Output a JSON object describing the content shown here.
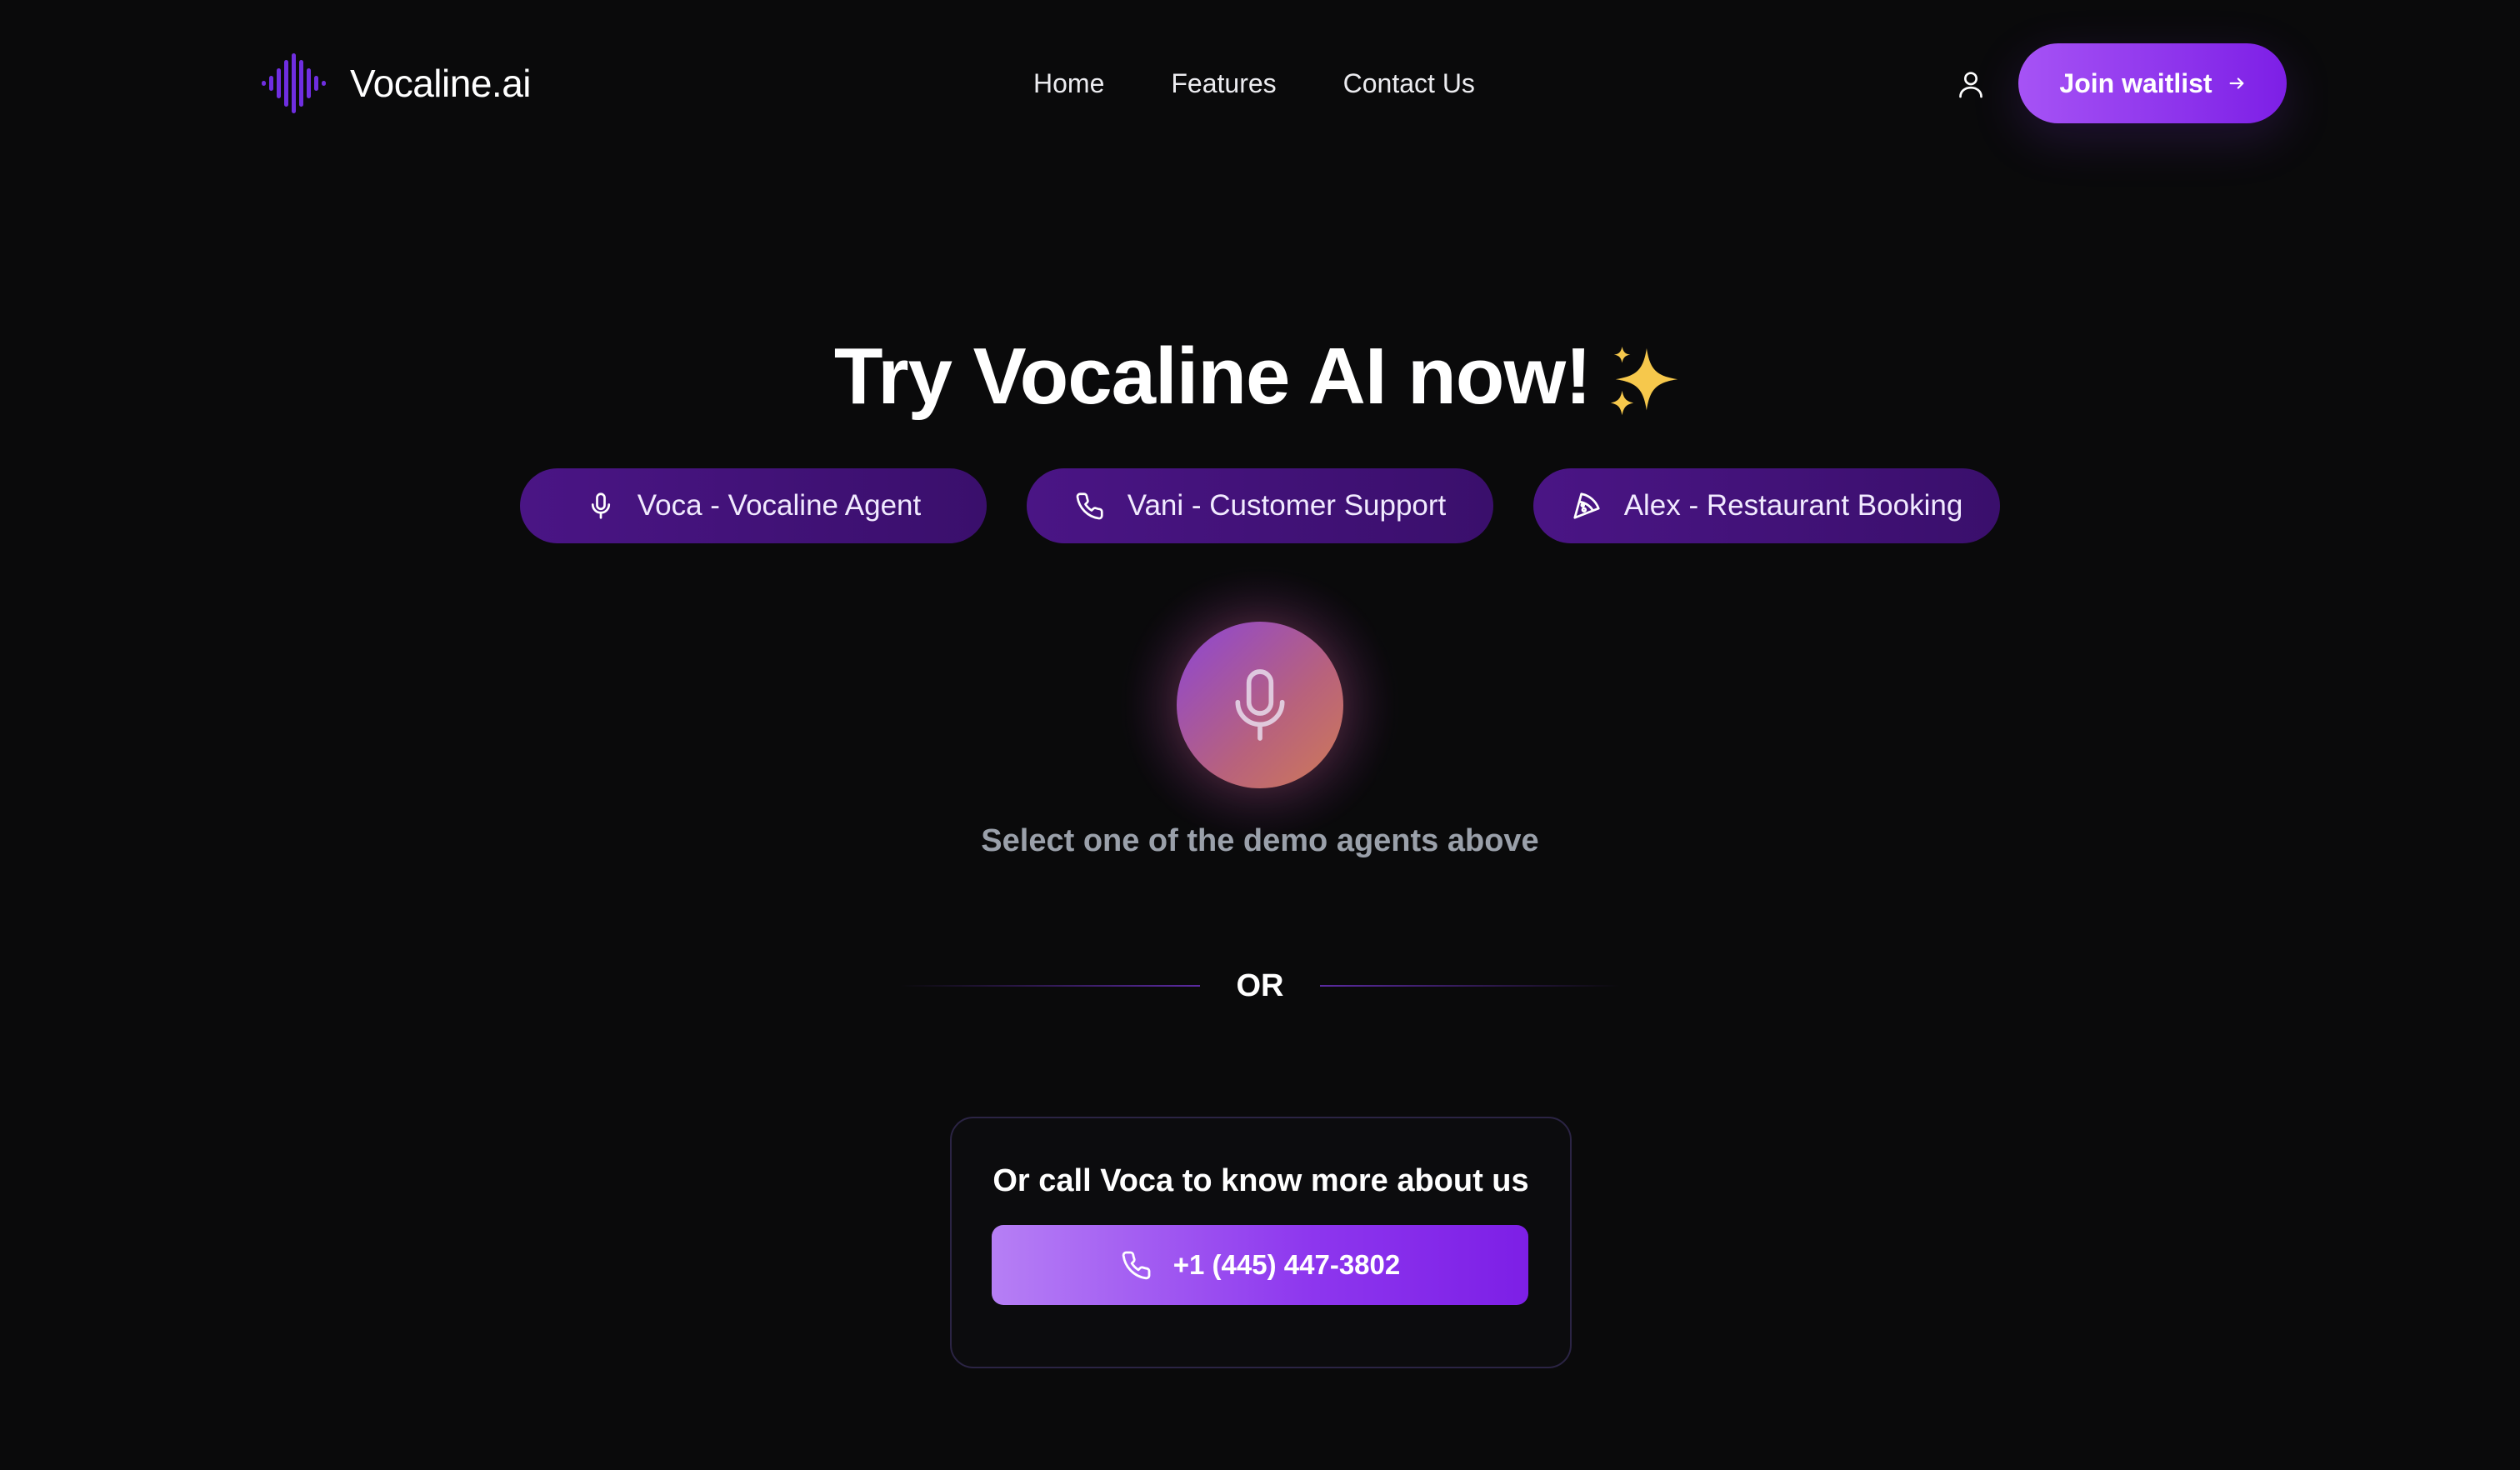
{
  "brand": {
    "name": "Vocaline.ai",
    "logo_icon": "waveform-icon",
    "accent": "#7b2ff0"
  },
  "nav": {
    "links": [
      {
        "label": "Home"
      },
      {
        "label": "Features"
      },
      {
        "label": "Contact Us"
      }
    ],
    "user_icon": "user-icon",
    "cta_label": "Join waitlist",
    "cta_icon": "arrow-right-icon"
  },
  "hero": {
    "title": "Try Vocaline AI now!",
    "title_icon": "sparkles-icon",
    "agents": [
      {
        "label": "Voca - Vocaline Agent",
        "icon": "microphone-icon"
      },
      {
        "label": "Vani - Customer Support",
        "icon": "phone-icon"
      },
      {
        "label": "Alex - Restaurant Booking",
        "icon": "pizza-slice-icon"
      }
    ],
    "mic_icon": "microphone-icon",
    "hint": "Select one of the demo agents above"
  },
  "divider": {
    "label": "OR"
  },
  "call": {
    "title": "Or call Voca to know more about us",
    "phone": "+1 (445) 447-3802",
    "phone_icon": "phone-icon"
  },
  "colors": {
    "background": "#0a0a0b",
    "pill": "#4a1585",
    "cta_start": "#a653f5",
    "cta_end": "#7d1fe6",
    "hint_text": "#9aa0aa"
  }
}
